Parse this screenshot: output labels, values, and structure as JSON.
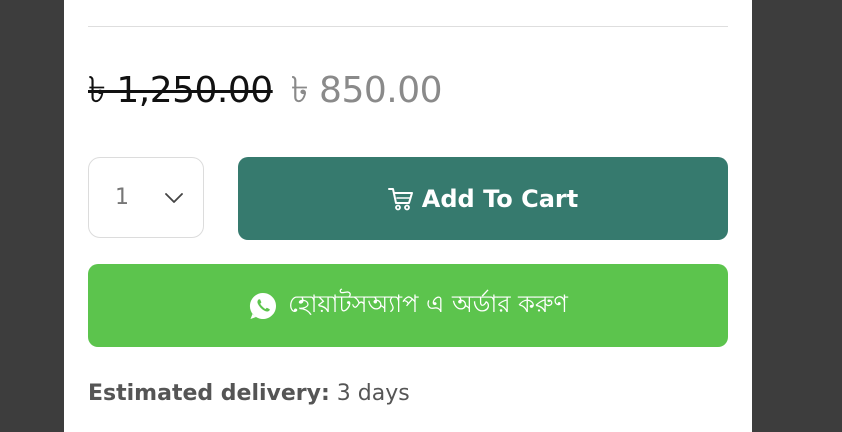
{
  "price": {
    "old": "৳ 1,250.00",
    "new": "৳ 850.00"
  },
  "quantity": {
    "selected": "1"
  },
  "cart_button": {
    "label": "Add To Cart",
    "icon": "cart-icon"
  },
  "whatsapp_button": {
    "label": "হোয়াটসঅ্যাপ এ অর্ডার করুণ",
    "icon": "whatsapp-icon"
  },
  "delivery": {
    "label": "Estimated delivery:",
    "value": " 3 days"
  },
  "colors": {
    "cart_button": "#367a6e",
    "whatsapp_button": "#5cc44d",
    "old_price": "#111111",
    "new_price": "#8a8a8a"
  }
}
